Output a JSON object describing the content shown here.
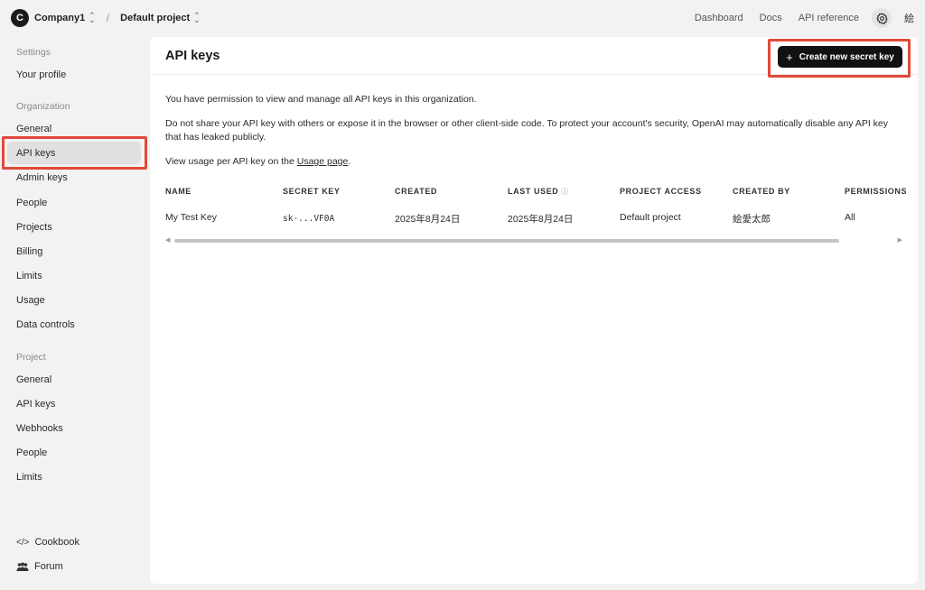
{
  "topbar": {
    "org_initial": "C",
    "org_name": "Company1",
    "project_name": "Default project",
    "nav": [
      "Dashboard",
      "Docs",
      "API reference"
    ],
    "user_initial": "絵"
  },
  "sidebar": {
    "sections": {
      "settings": "Settings",
      "organization": "Organization",
      "project": "Project"
    },
    "settings_items": [
      "Your profile"
    ],
    "org_items": [
      "General",
      "API keys",
      "Admin keys",
      "People",
      "Projects",
      "Billing",
      "Limits",
      "Usage",
      "Data controls"
    ],
    "project_items": [
      "General",
      "API keys",
      "Webhooks",
      "People",
      "Limits"
    ],
    "footer": [
      "Cookbook",
      "Forum"
    ]
  },
  "main": {
    "title": "API keys",
    "create_button": "Create new secret key",
    "para1": "You have permission to view and manage all API keys in this organization.",
    "para2": "Do not share your API key with others or expose it in the browser or other client-side code. To protect your account's security, OpenAI may automatically disable any API key that has leaked publicly.",
    "para3_prefix": "View usage per API key on the ",
    "para3_link": "Usage page",
    "para3_suffix": ".",
    "table": {
      "headers": [
        "NAME",
        "SECRET KEY",
        "CREATED",
        "LAST USED",
        "PROJECT ACCESS",
        "CREATED BY",
        "PERMISSIONS"
      ],
      "row": [
        "My Test Key",
        "sk-...VF0A",
        "2025年8月24日",
        "2025年8月24日",
        "Default project",
        "絵愛太郎",
        "All"
      ]
    }
  },
  "colors": {
    "highlight": "#e04a3a",
    "button_bg": "#111111"
  }
}
